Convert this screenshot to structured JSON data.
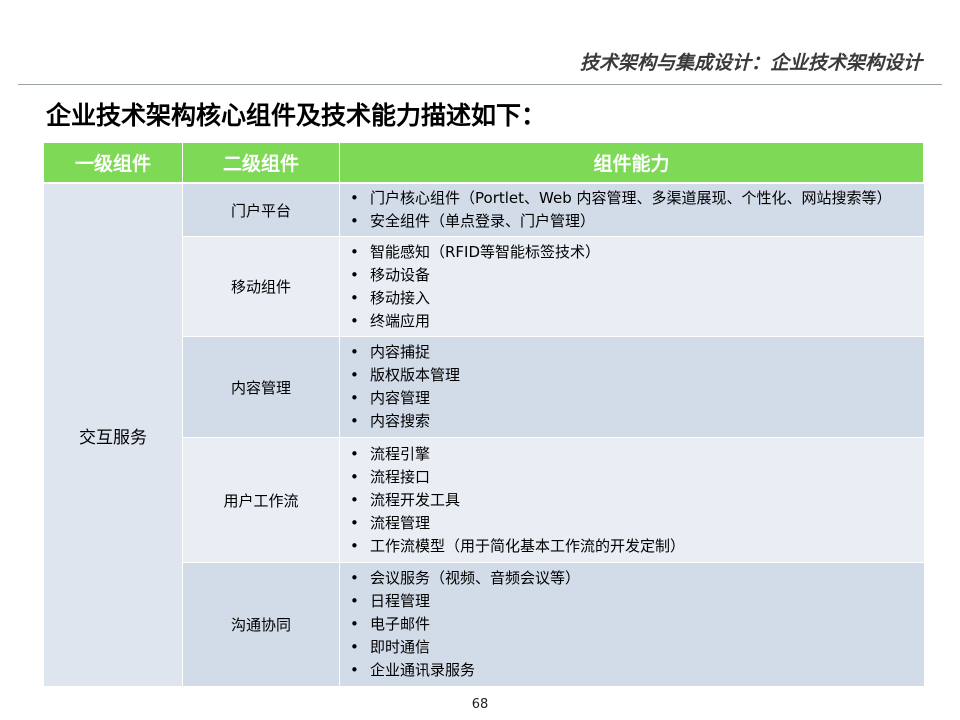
{
  "header": {
    "section_title": "技术架构与集成设计：企业技术架构设计"
  },
  "page_title": "企业技术架构核心组件及技术能力描述如下：",
  "table": {
    "columns": [
      "一级组件",
      "二级组件",
      "组件能力"
    ],
    "level1": "交互服务",
    "rows": [
      {
        "name": "门户平台",
        "items": [
          "门户核心组件（Portlet、Web 内容管理、多渠道展现、个性化、网站搜索等）",
          "安全组件（单点登录、门户管理）"
        ]
      },
      {
        "name": "移动组件",
        "items": [
          "智能感知（RFID等智能标签技术）",
          "移动设备",
          "移动接入",
          "终端应用"
        ]
      },
      {
        "name": "内容管理",
        "items": [
          "内容捕捉",
          "版权版本管理",
          "内容管理",
          "内容搜索"
        ]
      },
      {
        "name": "用户工作流",
        "items": [
          "流程引擎",
          "流程接口",
          "流程开发工具",
          "流程管理",
          "工作流模型（用于简化基本工作流的开发定制）"
        ]
      },
      {
        "name": "沟通协同",
        "items": [
          "会议服务（视频、音频会议等）",
          "日程管理",
          "电子邮件",
          "即时通信",
          "企业通讯录服务"
        ]
      }
    ]
  },
  "page_number": "68",
  "colors": {
    "header_green": "#7ed957",
    "row_dark": "#d2dbe8",
    "row_light": "#e9edf4"
  }
}
